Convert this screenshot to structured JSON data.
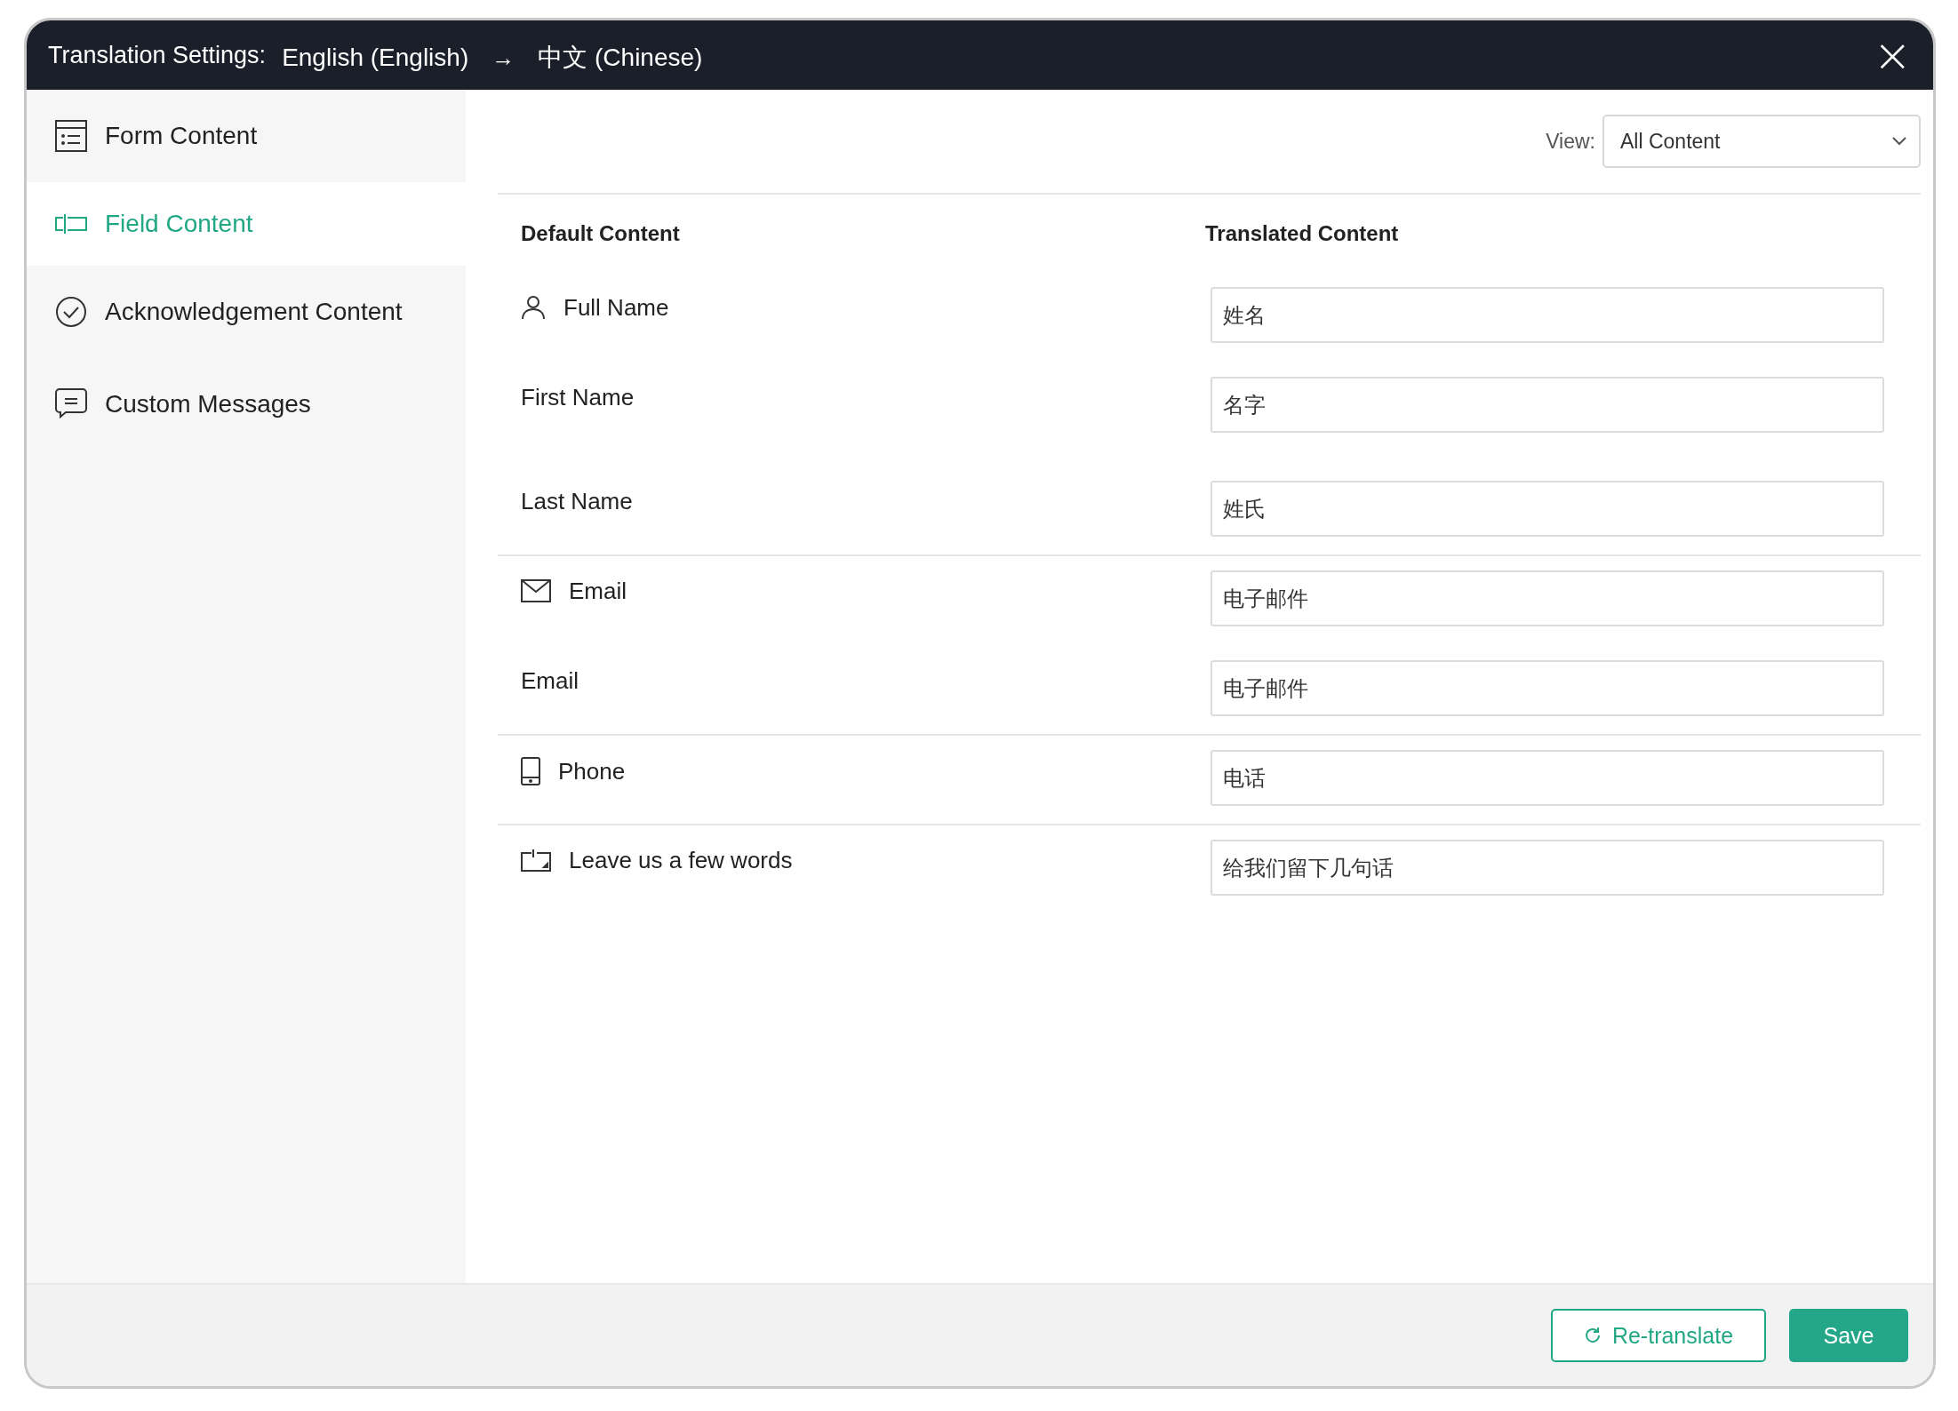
{
  "window": {
    "title": "Translation Settings:",
    "source_language": "English (English)",
    "arrow": "→",
    "target_language": "中文 (Chinese)",
    "close": "×"
  },
  "sidebar": {
    "items": [
      {
        "kind": "form",
        "label": "Form Content",
        "selected": false
      },
      {
        "kind": "field",
        "label": "Field Content",
        "selected": true
      },
      {
        "kind": "acknowledgement",
        "label": "Acknowledgement Content",
        "selected": false
      },
      {
        "kind": "messages",
        "label": "Custom Messages",
        "selected": false
      }
    ]
  },
  "view": {
    "label": "View:",
    "value": "All Content"
  },
  "table": {
    "columns": [
      "Default Content",
      "Translated Content"
    ],
    "groups": [
      {
        "kind": "name",
        "fields": [
          {
            "label": "Full Name",
            "value": "姓名"
          },
          {
            "label": "First Name",
            "value": "名字"
          },
          {
            "label": "Last Name",
            "value": "姓氏"
          }
        ]
      },
      {
        "kind": "email",
        "fields": [
          {
            "label": "Email",
            "value": "电子邮件"
          },
          {
            "label": "Email",
            "value": "电子邮件"
          }
        ]
      },
      {
        "kind": "phone",
        "fields": [
          {
            "label": "Phone",
            "value": "电话"
          }
        ]
      },
      {
        "kind": "textarea",
        "fields": [
          {
            "label": "Leave us a few words",
            "value": "给我们留下几句话"
          }
        ]
      }
    ]
  },
  "buttons": {
    "retranslate": "Re-translate",
    "save": "Save"
  }
}
